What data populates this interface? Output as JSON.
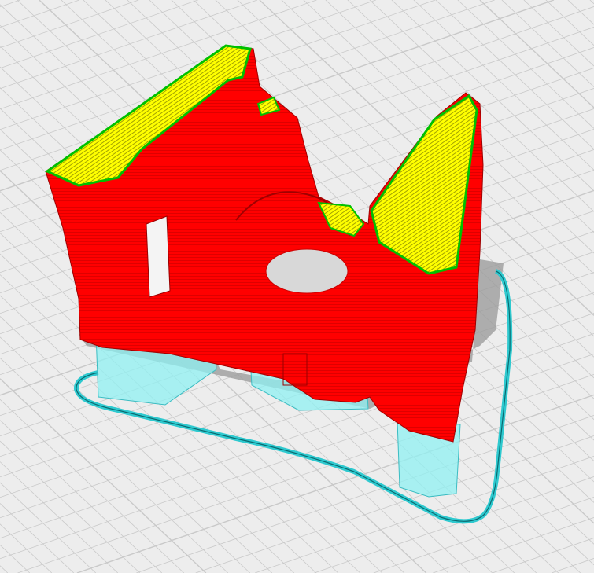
{
  "viewport": {
    "view": "layer-preview",
    "colors": {
      "background": "#ededed",
      "grid": "#c9c9c9",
      "wall": "#ff0000",
      "top_skin": "#ffff00",
      "inner_wall": "#00cc00",
      "support": "#7fe8ea",
      "skirt": "#33d6dc",
      "shadow": "#9a9a9a"
    }
  }
}
